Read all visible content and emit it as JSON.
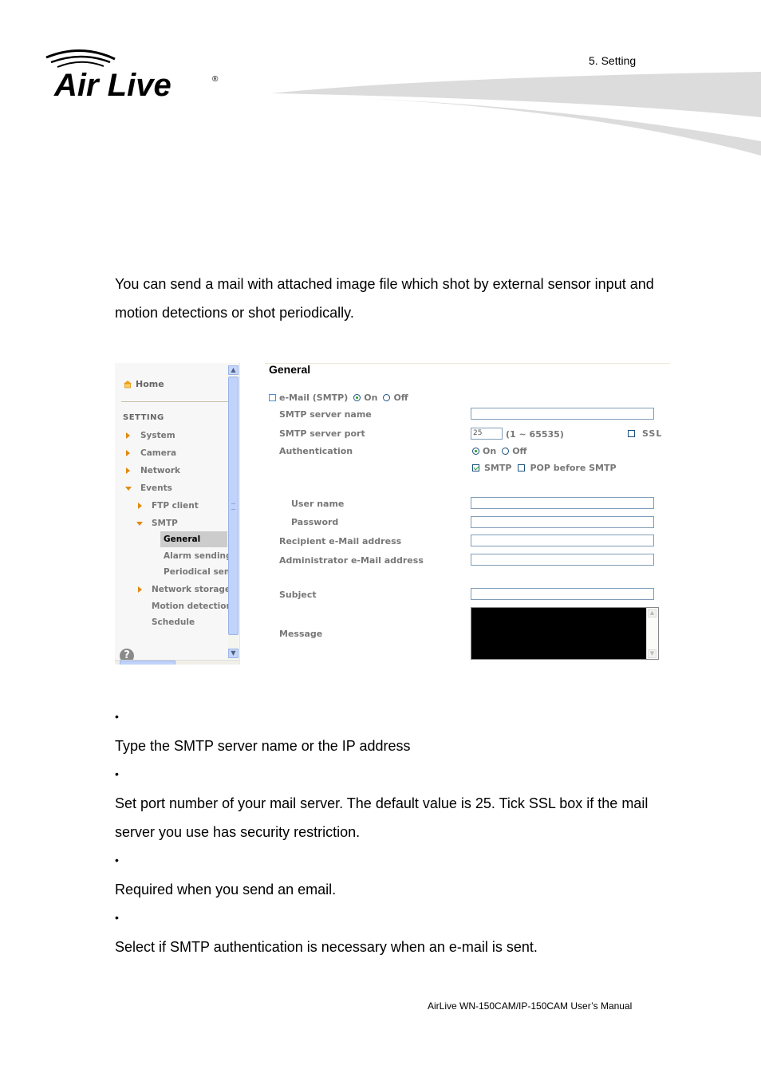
{
  "header": {
    "logo_text": "Air Live",
    "logo_registered": "®",
    "chapter": "5.  Setting"
  },
  "intro": "You can send a mail with attached image file which shot by external sensor input and motion detections or shot periodically.",
  "screenshot": {
    "nav": {
      "home": "Home",
      "section_title": "SETTING",
      "items": [
        {
          "label": "System",
          "icon": "triangle-right-icon"
        },
        {
          "label": "Camera",
          "icon": "triangle-right-icon"
        },
        {
          "label": "Network",
          "icon": "triangle-right-icon"
        },
        {
          "label": "Events",
          "icon": "triangle-down-icon"
        },
        {
          "label": "FTP client",
          "icon": "triangle-right-icon"
        },
        {
          "label": "SMTP",
          "icon": "triangle-down-icon"
        },
        {
          "label": "General",
          "active": true
        },
        {
          "label": "Alarm sending"
        },
        {
          "label": "Periodical send"
        },
        {
          "label": "Network storage",
          "icon": "triangle-right-icon"
        },
        {
          "label": "Motion detection"
        },
        {
          "label": "Schedule"
        }
      ],
      "help": "?"
    },
    "form": {
      "title": "General",
      "email_smtp_label": "e-Mail (SMTP)",
      "email_on": "On",
      "email_off": "Off",
      "smtp_server_name_label": "SMTP server name",
      "smtp_server_name_value": "",
      "smtp_server_port_label": "SMTP server port",
      "smtp_port_value": "25",
      "smtp_port_range": "(1 ~ 65535)",
      "ssl_label": "SSL",
      "authentication_label": "Authentication",
      "auth_on": "On",
      "auth_off": "Off",
      "smtp_option": "SMTP",
      "pop_option": "POP before SMTP",
      "user_name_label": "User name",
      "password_label": "Password",
      "recipient_label": "Recipient e-Mail address",
      "admin_label": "Administrator e-Mail address",
      "subject_label": "Subject",
      "message_label": "Message"
    }
  },
  "bullets": [
    {
      "symbol": "•",
      "text": "Type the SMTP server name or the IP address"
    },
    {
      "symbol": "•",
      "text": "Set port number of your mail server. The default value is 25. Tick SSL box if the mail server you use has security restriction."
    },
    {
      "symbol": "•",
      "text": "Required when you send an email."
    },
    {
      "symbol": "•",
      "text": "Select if SMTP authentication is necessary when an e-mail is sent."
    }
  ],
  "footer": "AirLive WN-150CAM/IP-150CAM User’s Manual"
}
